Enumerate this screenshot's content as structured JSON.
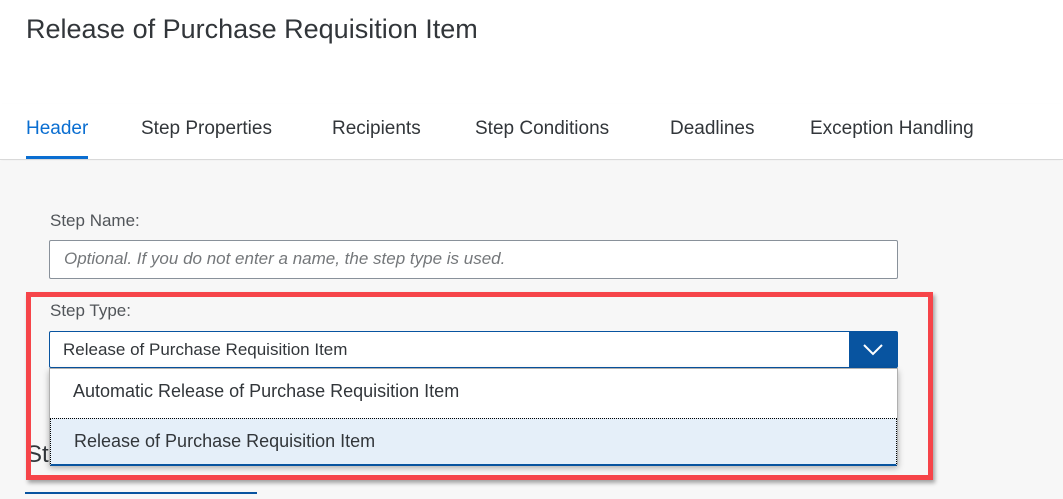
{
  "title": "Release of Purchase Requisition Item",
  "tabs": [
    {
      "label": "Header",
      "active": true
    },
    {
      "label": "Step Properties"
    },
    {
      "label": "Recipients"
    },
    {
      "label": "Step Conditions"
    },
    {
      "label": "Deadlines"
    },
    {
      "label": "Exception Handling"
    }
  ],
  "form": {
    "step_name_label": "Step Name:",
    "step_name_placeholder": "Optional. If you do not enter a name, the step type is used.",
    "step_type_label": "Step Type:",
    "step_type_value": "Release of Purchase Requisition Item",
    "options": [
      "Automatic Release of Purchase Requisition Item",
      "Release of Purchase Requisition Item"
    ],
    "partial_heading": "St"
  },
  "colors": {
    "accent": "#0854a0",
    "highlight": "#f64449",
    "selected_option": "#e5eff9"
  }
}
